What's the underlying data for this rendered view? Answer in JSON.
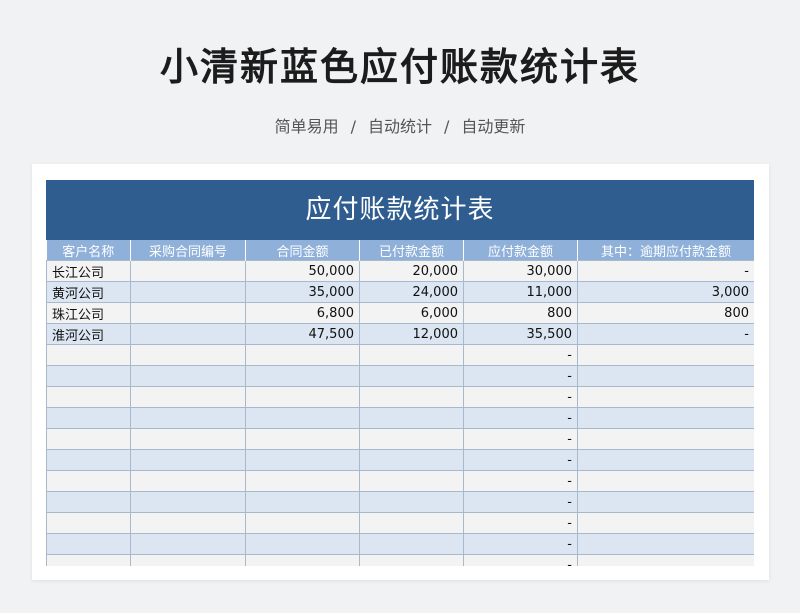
{
  "header": {
    "title": "小清新蓝色应付账款统计表",
    "tags": [
      "简单易用",
      "自动统计",
      "自动更新"
    ],
    "separator": "/"
  },
  "sheet": {
    "title": "应付账款统计表",
    "columns": [
      "客户名称",
      "采购合同编号",
      "合同金额",
      "已付款金额",
      "应付款金额",
      "其中：逾期应付款金额"
    ],
    "rows": [
      [
        "长江公司",
        "",
        "50,000",
        "20,000",
        "30,000",
        "-"
      ],
      [
        "黄河公司",
        "",
        "35,000",
        "24,000",
        "11,000",
        "3,000"
      ],
      [
        "珠江公司",
        "",
        "6,800",
        "6,000",
        "800",
        "800"
      ],
      [
        "淮河公司",
        "",
        "47,500",
        "12,000",
        "35,500",
        "-"
      ],
      [
        "",
        "",
        "",
        "",
        "-",
        ""
      ],
      [
        "",
        "",
        "",
        "",
        "-",
        ""
      ],
      [
        "",
        "",
        "",
        "",
        "-",
        ""
      ],
      [
        "",
        "",
        "",
        "",
        "-",
        ""
      ],
      [
        "",
        "",
        "",
        "",
        "-",
        ""
      ],
      [
        "",
        "",
        "",
        "",
        "-",
        ""
      ],
      [
        "",
        "",
        "",
        "",
        "-",
        ""
      ],
      [
        "",
        "",
        "",
        "",
        "-",
        ""
      ],
      [
        "",
        "",
        "",
        "",
        "-",
        ""
      ],
      [
        "",
        "",
        "",
        "",
        "-",
        ""
      ],
      [
        "",
        "",
        "",
        "",
        "-",
        ""
      ]
    ]
  },
  "colors": {
    "title_bar": "#2f5d8f",
    "header_row": "#8fb0d9",
    "row_light": "#f3f3f3",
    "row_blue": "#dbe6f2",
    "background": "#f1f2f4"
  }
}
